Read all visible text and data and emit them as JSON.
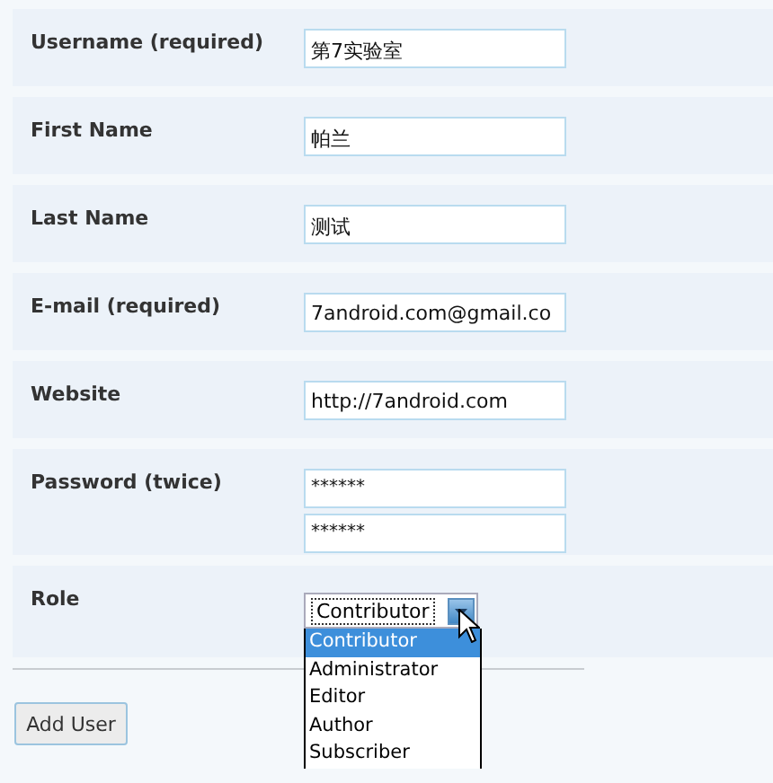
{
  "fields": [
    {
      "kind": "text",
      "label": "Username (required)",
      "values": [
        "第7实验室"
      ]
    },
    {
      "kind": "text",
      "label": "First Name",
      "values": [
        "帕兰"
      ]
    },
    {
      "kind": "text",
      "label": "Last Name",
      "values": [
        "测试"
      ]
    },
    {
      "kind": "text",
      "label": "E-mail (required)",
      "values": [
        "7android.com@gmail.co"
      ]
    },
    {
      "kind": "text",
      "label": "Website",
      "values": [
        "http://7android.com"
      ]
    },
    {
      "kind": "password",
      "label": "Password (twice)",
      "values": [
        "******",
        "******"
      ]
    },
    {
      "kind": "select",
      "label": "Role",
      "values": [
        "Contributor"
      ],
      "options": [
        {
          "label": "Contributor",
          "selected": true
        },
        {
          "label": "Administrator",
          "selected": false
        },
        {
          "label": "Editor",
          "selected": false
        },
        {
          "label": "Author",
          "selected": false
        },
        {
          "label": "Subscriber",
          "selected": false
        }
      ]
    }
  ],
  "submit_button": "Add User"
}
